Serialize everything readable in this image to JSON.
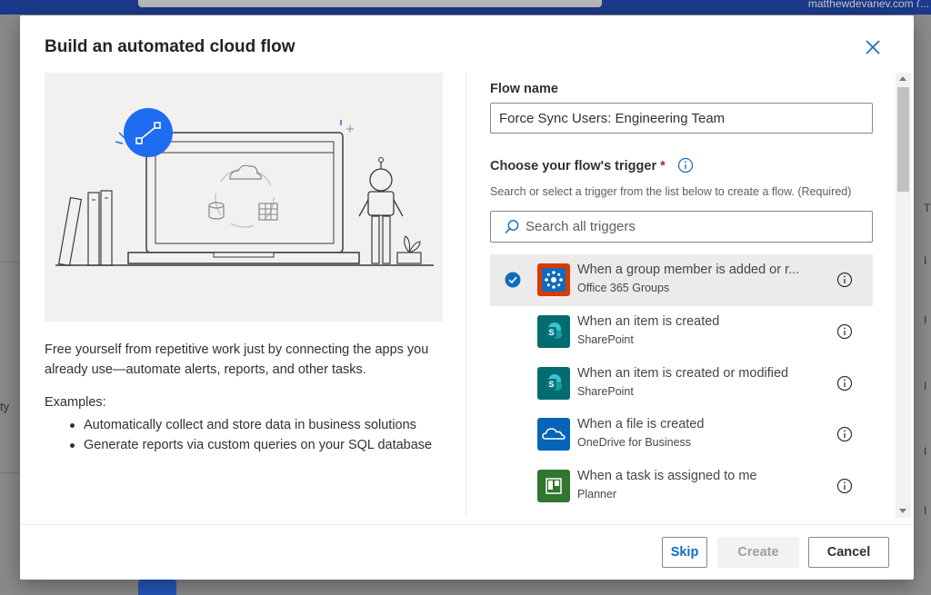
{
  "background": {
    "user_text": "matthewdevaney.com (...",
    "left_fragment": "ty",
    "right_glyphs": [
      "T",
      "I",
      "I",
      "I",
      "I",
      "I"
    ]
  },
  "dialog": {
    "title": "Build an automated cloud flow",
    "description": "Free yourself from repetitive work just by connecting the apps you already use—automate alerts, reports, and other tasks.",
    "examples_label": "Examples:",
    "examples": [
      "Automatically collect and store data in business solutions",
      "Generate reports via custom queries on your SQL database"
    ],
    "flow_name_label": "Flow name",
    "flow_name_value": "Force Sync Users: Engineering Team",
    "trigger_label": "Choose your flow's trigger",
    "trigger_required_mark": "*",
    "trigger_help": "Search or select a trigger from the list below to create a flow. (Required)",
    "search_placeholder": "Search all triggers",
    "triggers": [
      {
        "name": "When a group member is added or r...",
        "connector": "Office 365 Groups",
        "icon": "office365-groups-icon",
        "color": "#d83b01",
        "selected": true
      },
      {
        "name": "When an item is created",
        "connector": "SharePoint",
        "icon": "sharepoint-icon",
        "color": "#036c70",
        "selected": false
      },
      {
        "name": "When an item is created or modified",
        "connector": "SharePoint",
        "icon": "sharepoint-icon",
        "color": "#036c70",
        "selected": false
      },
      {
        "name": "When a file is created",
        "connector": "OneDrive for Business",
        "icon": "onedrive-icon",
        "color": "#0364b8",
        "selected": false
      },
      {
        "name": "When a task is assigned to me",
        "connector": "Planner",
        "icon": "planner-icon",
        "color": "#31752f",
        "selected": false
      }
    ],
    "buttons": {
      "skip": "Skip",
      "create": "Create",
      "cancel": "Cancel"
    },
    "colors": {
      "accent": "#0f6cbd",
      "hero_badge": "#1e6cf0",
      "required": "#a4262c"
    }
  }
}
